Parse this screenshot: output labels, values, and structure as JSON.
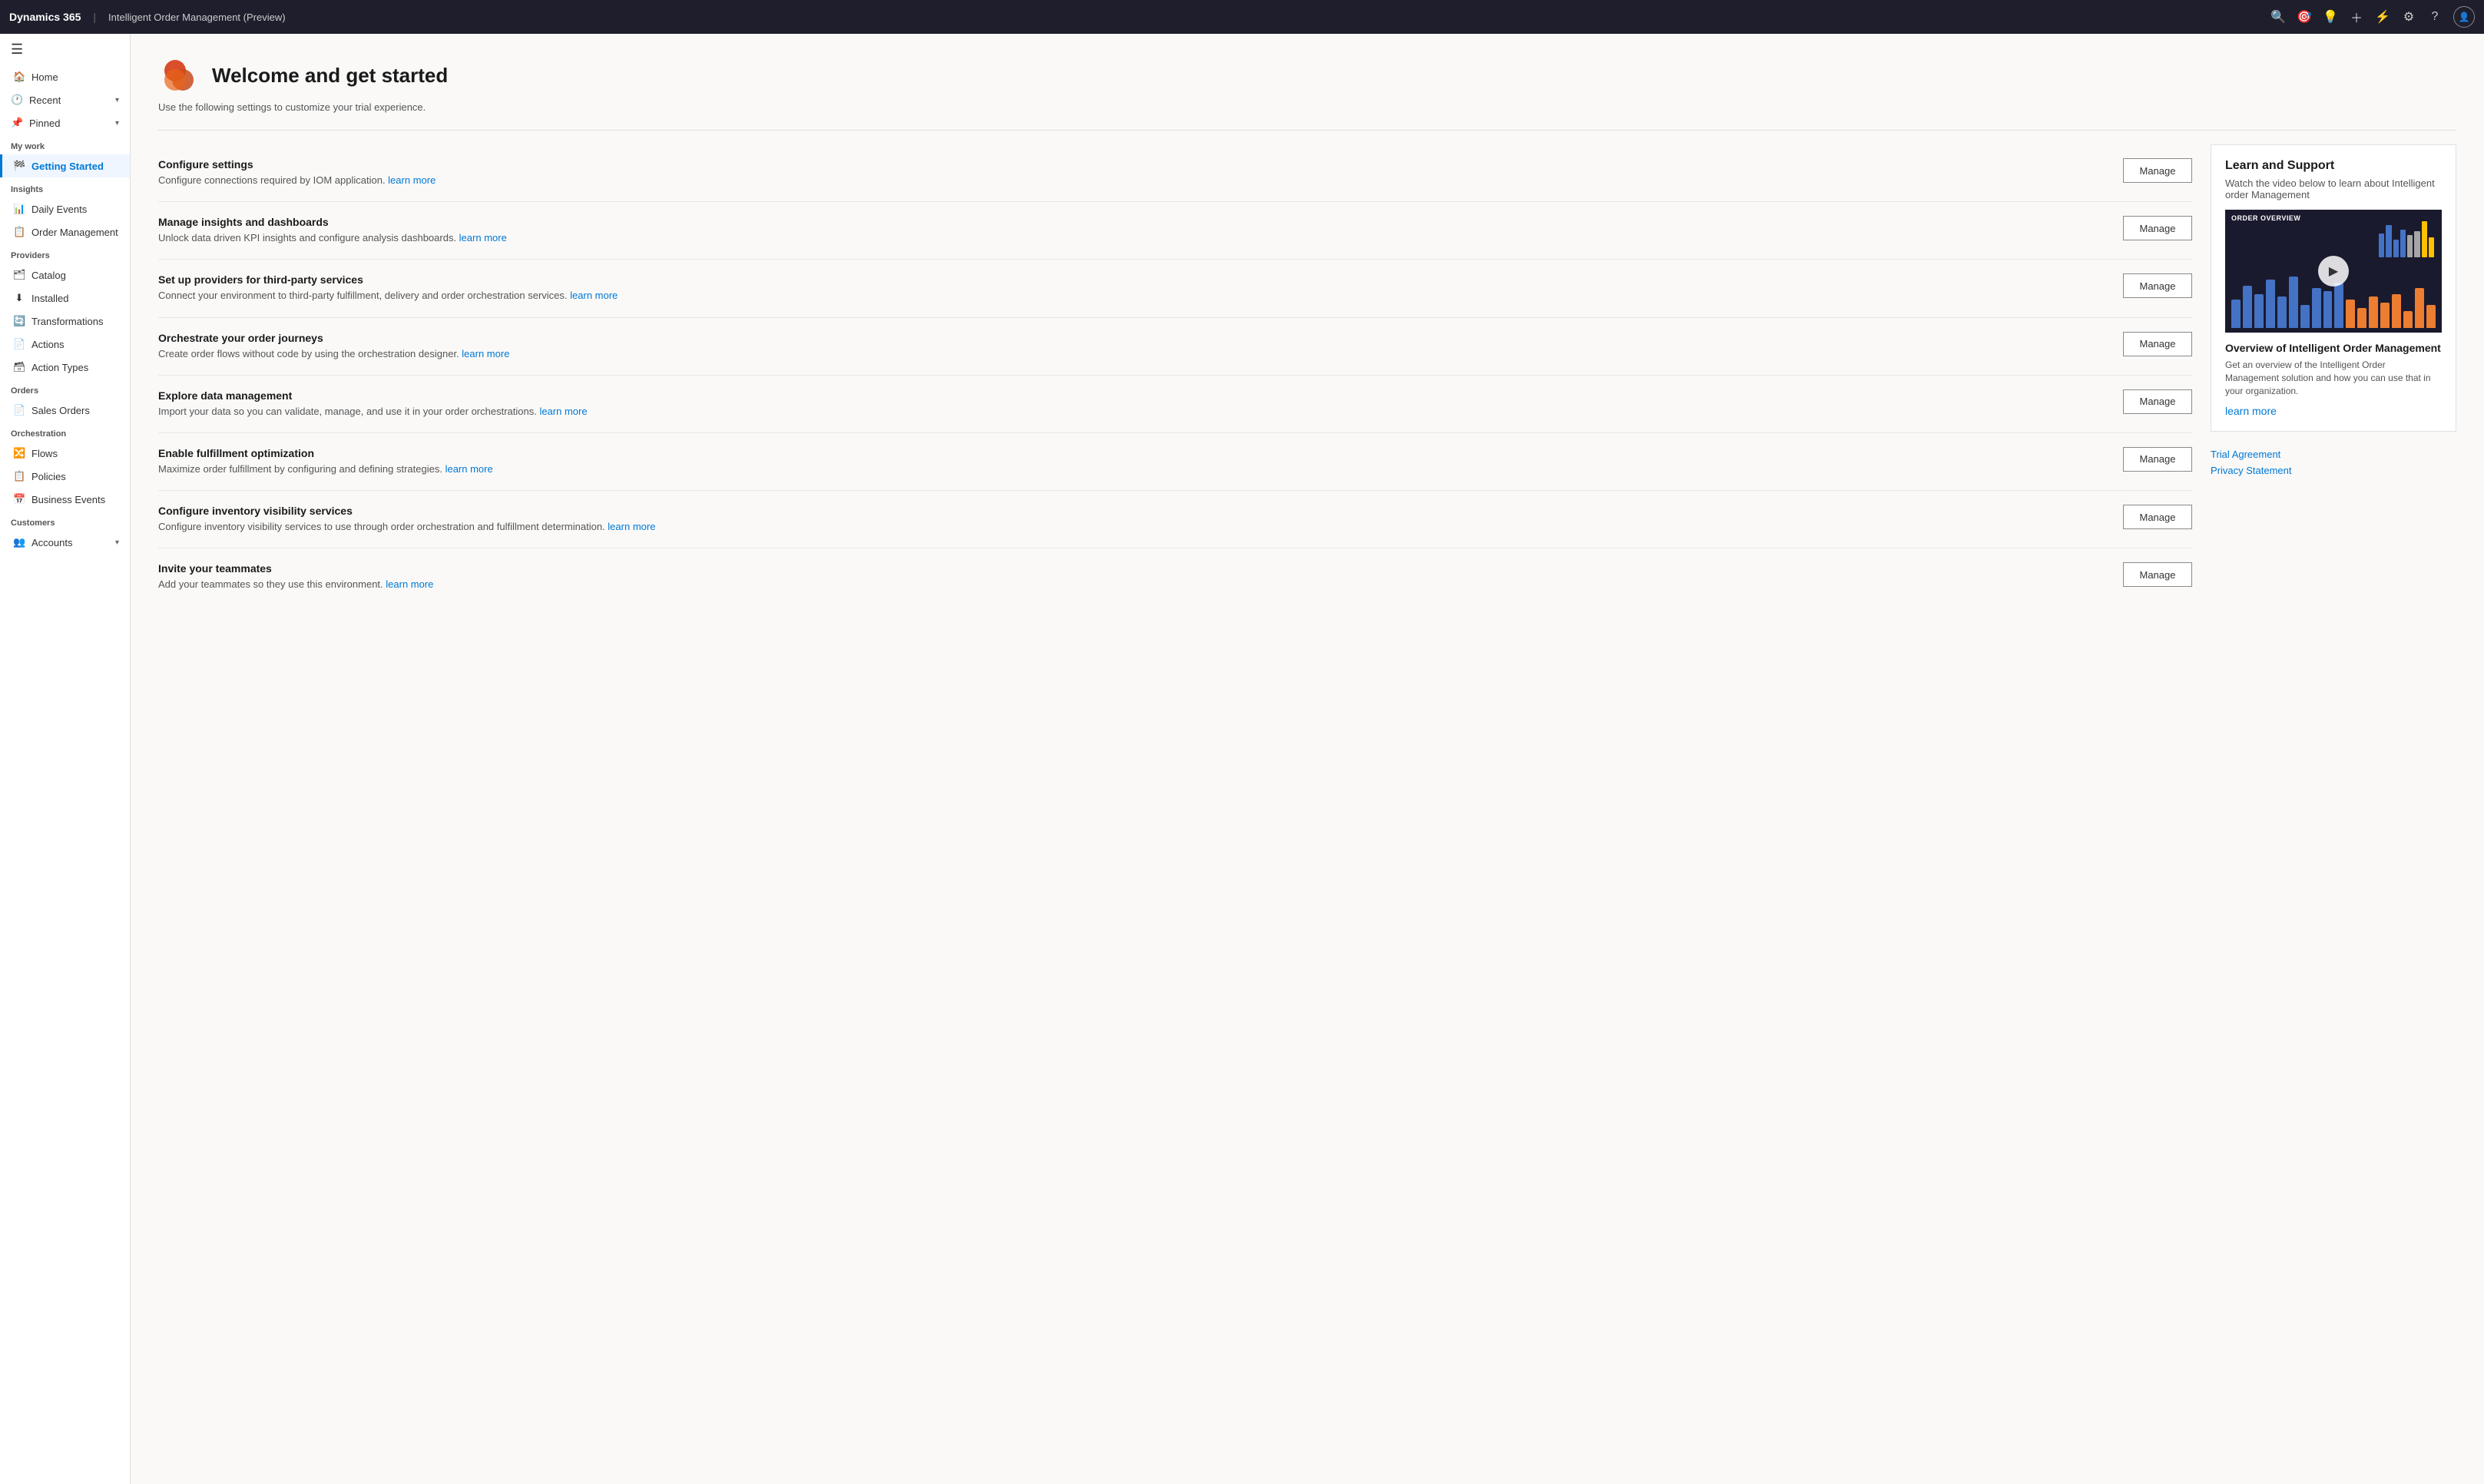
{
  "topNav": {
    "brand": "Dynamics 365",
    "divider": "|",
    "title": "Intelligent Order Management (Preview)",
    "icons": [
      "search",
      "target",
      "lightbulb",
      "plus",
      "filter",
      "settings",
      "help"
    ],
    "avatar": "👤"
  },
  "sidebar": {
    "menuBtn": "☰",
    "topItems": [
      {
        "id": "home",
        "label": "Home",
        "icon": "🏠"
      },
      {
        "id": "recent",
        "label": "Recent",
        "icon": "🕐",
        "expand": true
      },
      {
        "id": "pinned",
        "label": "Pinned",
        "icon": "📌",
        "expand": true
      }
    ],
    "sections": [
      {
        "label": "My work",
        "items": [
          {
            "id": "getting-started",
            "label": "Getting Started",
            "icon": "🏁",
            "active": true
          }
        ]
      },
      {
        "label": "Insights",
        "items": [
          {
            "id": "daily-events",
            "label": "Daily Events",
            "icon": "📊"
          },
          {
            "id": "order-management",
            "label": "Order Management",
            "icon": "📋"
          }
        ]
      },
      {
        "label": "Providers",
        "items": [
          {
            "id": "catalog",
            "label": "Catalog",
            "icon": "🗂"
          },
          {
            "id": "installed",
            "label": "Installed",
            "icon": "⬇"
          },
          {
            "id": "transformations",
            "label": "Transformations",
            "icon": "🔄"
          },
          {
            "id": "actions",
            "label": "Actions",
            "icon": "📄"
          },
          {
            "id": "action-types",
            "label": "Action Types",
            "icon": "🗃"
          }
        ]
      },
      {
        "label": "Orders",
        "items": [
          {
            "id": "sales-orders",
            "label": "Sales Orders",
            "icon": "📄"
          }
        ]
      },
      {
        "label": "Orchestration",
        "items": [
          {
            "id": "flows",
            "label": "Flows",
            "icon": "🔀"
          },
          {
            "id": "policies",
            "label": "Policies",
            "icon": "📋"
          },
          {
            "id": "business-events",
            "label": "Business Events",
            "icon": "📅"
          }
        ]
      },
      {
        "label": "Customers",
        "items": [
          {
            "id": "accounts",
            "label": "Accounts",
            "icon": "👥"
          }
        ]
      }
    ]
  },
  "main": {
    "title": "Welcome and get started",
    "subtitle": "Use the following settings to customize your trial experience.",
    "tasks": [
      {
        "id": "configure-settings",
        "title": "Configure settings",
        "desc": "Configure connections required by IOM application.",
        "learnMoreText": "learn more",
        "btnLabel": "Manage"
      },
      {
        "id": "manage-insights",
        "title": "Manage insights and dashboards",
        "desc": "Unlock data driven KPI insights and configure analysis dashboards.",
        "learnMoreText": "learn more",
        "btnLabel": "Manage"
      },
      {
        "id": "providers",
        "title": "Set up providers for third-party services",
        "desc": "Connect your environment to third-party fulfillment, delivery and order orchestration services.",
        "learnMoreText": "learn more",
        "btnLabel": "Manage"
      },
      {
        "id": "orchestrate",
        "title": "Orchestrate your order journeys",
        "desc": "Create order flows without code by using the orchestration designer.",
        "learnMoreText": "learn more",
        "btnLabel": "Manage"
      },
      {
        "id": "data-management",
        "title": "Explore data management",
        "desc": "Import your data so you can validate, manage, and use it in your order orchestrations.",
        "learnMoreText": "learn more",
        "btnLabel": "Manage"
      },
      {
        "id": "fulfillment",
        "title": "Enable fulfillment optimization",
        "desc": "Maximize order fulfillment by configuring and defining strategies.",
        "learnMoreText": "learn more",
        "btnLabel": "Manage"
      },
      {
        "id": "inventory",
        "title": "Configure inventory visibility services",
        "desc": "Configure inventory visibility services to use through order orchestration and fulfillment determination.",
        "learnMoreText": "learn more",
        "btnLabel": "Manage"
      },
      {
        "id": "teammates",
        "title": "Invite your teammates",
        "desc": "Add your teammates so they use this environment.",
        "learnMoreText": "learn more",
        "btnLabel": "Manage"
      }
    ]
  },
  "learnSupport": {
    "title": "Learn and Support",
    "subtitle": "Watch the video below to learn about Intelligent order Management",
    "videoTitle": "Overview of Intelligent Order Management",
    "videoDesc": "Get an overview of the Intelligent Order Management solution and how you can use that in your organization.",
    "learnMoreLink": "learn more",
    "trialAgreement": "Trial Agreement",
    "privacyStatement": "Privacy Statement",
    "bars": [
      {
        "height": 50,
        "color": "#4472c4"
      },
      {
        "height": 75,
        "color": "#4472c4"
      },
      {
        "height": 60,
        "color": "#4472c4"
      },
      {
        "height": 85,
        "color": "#4472c4"
      },
      {
        "height": 55,
        "color": "#4472c4"
      },
      {
        "height": 90,
        "color": "#4472c4"
      },
      {
        "height": 40,
        "color": "#4472c4"
      },
      {
        "height": 70,
        "color": "#4472c4"
      },
      {
        "height": 65,
        "color": "#4472c4"
      },
      {
        "height": 80,
        "color": "#4472c4"
      },
      {
        "height": 50,
        "color": "#ed7d31"
      },
      {
        "height": 35,
        "color": "#ed7d31"
      },
      {
        "height": 55,
        "color": "#ed7d31"
      },
      {
        "height": 45,
        "color": "#ed7d31"
      },
      {
        "height": 60,
        "color": "#ed7d31"
      },
      {
        "height": 30,
        "color": "#ed7d31"
      },
      {
        "height": 70,
        "color": "#ed7d31"
      },
      {
        "height": 40,
        "color": "#ed7d31"
      }
    ],
    "overlayBars": [
      {
        "height": 60,
        "color": "#4472c4"
      },
      {
        "height": 80,
        "color": "#4472c4"
      },
      {
        "height": 45,
        "color": "#4472c4"
      },
      {
        "height": 70,
        "color": "#4472c4"
      },
      {
        "height": 55,
        "color": "#a5a5a5"
      },
      {
        "height": 65,
        "color": "#a5a5a5"
      },
      {
        "height": 90,
        "color": "#ffc000"
      },
      {
        "height": 50,
        "color": "#ffc000"
      }
    ]
  }
}
